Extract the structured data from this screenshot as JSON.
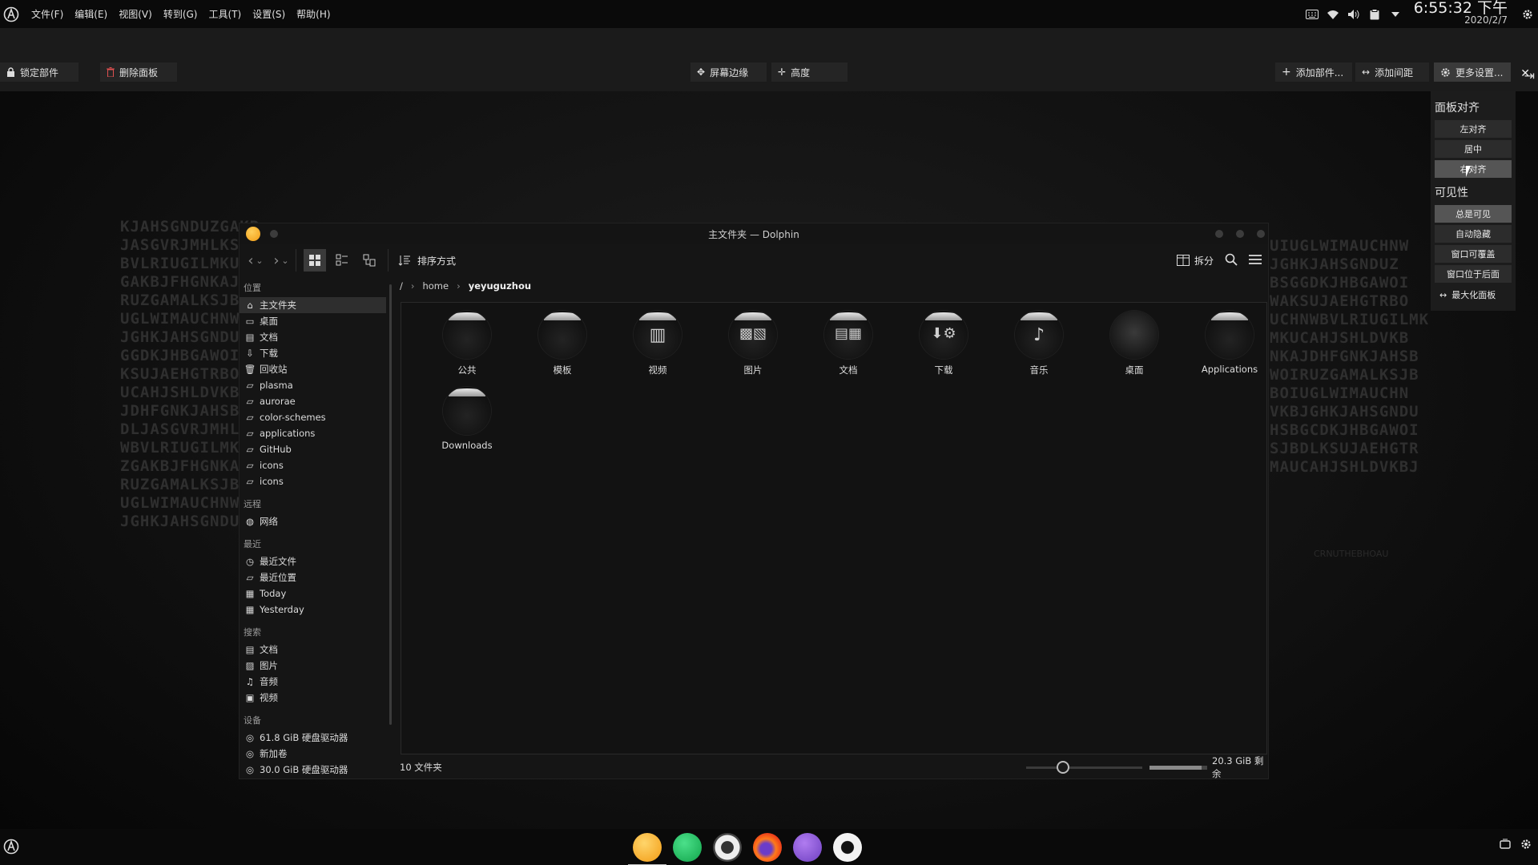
{
  "wallpaper": {
    "left_text": "KJAHSGNDUZGAKB\nJASGVRJMHLKSUJ\nBVLRIUGILMKUCA\nGAKBJFHGNKAJDH\nRUZGAMALKSJBDL\nUGLWIMAUCHNWB\nJGHKJAHSGNDUZG\nGGDKJHBGAWOIRU\nKSUJAEHGTRBOIU\nUCAHJSHLDVKBJG\nJDHFGNKJAHSBCG\nDLJASGVRJMHLKS\nWBVLRIUGILMKUC\nZGAKBJFHGNKAJD\nRUZGAMALKSJBDL\nUGLWIMAUCHNWB\nJGHKJAHSGNDUZG",
    "right_text": "UIUGLWIMAUCHNW\nJGHKJAHSGNDUZ\nBSGGDKJHBGAWOI\nWAKSUJAEHGTRBO\nUCHNWBVLRIUGILMK\nMKUCAHJSHLDVKB\nNKAJDHFGNKJAHSB\nWOIRUZGAMALKSJB\nBOIUGLWIMAUCHN\nVKBJGHKJAHSGNDU\nHSBGCDKJHBGAWOI\nSJBDLKSUJAEHGTR\nMAUCAHJSHLDVKBJ",
    "signature": "CRNUTHEBHOAU"
  },
  "top_panel": {
    "menus": [
      "文件(F)",
      "编辑(E)",
      "视图(V)",
      "转到(G)",
      "工具(T)",
      "设置(S)",
      "帮助(H)"
    ],
    "clock_time": "6:55:32 下午",
    "clock_date": "2020/2/7",
    "tray_icons": [
      "keyboard-icon",
      "network-icon",
      "volume-icon",
      "clipboard-icon",
      "expand-tray-icon",
      "settings-icon"
    ]
  },
  "panel_edit": {
    "lock_label": "锁定部件",
    "remove_label": "删除面板",
    "screen_edge_label": "屏幕边缘",
    "height_label": "高度",
    "add_widget_label": "添加部件...",
    "add_spacer_label": "添加间距",
    "more_settings_label": "更多设置..."
  },
  "more_settings": {
    "align_title": "面板对齐",
    "align_left": "左对齐",
    "align_center": "居中",
    "align_right": "右对齐",
    "visibility_title": "可见性",
    "vis_always": "总是可见",
    "vis_autohide": "自动隐藏",
    "vis_cover": "窗口可覆盖",
    "vis_below": "窗口位于后面",
    "maximize": "最大化面板"
  },
  "dolphin": {
    "title": "主文件夹 — Dolphin",
    "sort_label": "排序方式",
    "split_label": "拆分",
    "breadcrumb": {
      "root": "/",
      "home": "home",
      "current": "yeyuguzhou"
    },
    "places": {
      "group_places": "位置",
      "places_items": [
        "主文件夹",
        "桌面",
        "文档",
        "下载",
        "回收站",
        "plasma",
        "aurorae",
        "color-schemes",
        "applications",
        "GitHub",
        "icons",
        "icons"
      ],
      "group_remote": "远程",
      "remote_items": [
        "网络"
      ],
      "group_recent": "最近",
      "recent_items": [
        "最近文件",
        "最近位置",
        "Today",
        "Yesterday"
      ],
      "group_search": "搜索",
      "search_items": [
        "文档",
        "图片",
        "音频",
        "视频"
      ],
      "group_devices": "设备",
      "device_items": [
        "61.8 GiB 硬盘驱动器",
        "新加卷",
        "30.0 GiB 硬盘驱动器"
      ]
    },
    "files": [
      "公共",
      "模板",
      "视频",
      "图片",
      "文档",
      "下载",
      "音乐",
      "桌面",
      "Applications",
      "Downloads"
    ],
    "status_count": "10 文件夹",
    "free_space": "20.3 GiB 剩余",
    "free_space_used_fraction": 0.9
  },
  "dock": {
    "apps": [
      "dolphin-icon",
      "terminal-icon",
      "settings-app-icon",
      "firefox-icon",
      "github-desktop-icon",
      "inkscape-icon"
    ]
  },
  "colors": {
    "panel_bg": "#0a0a0a",
    "window_bg": "#151515",
    "checked_button": "#555555",
    "accent_orange": "#f29b14"
  }
}
